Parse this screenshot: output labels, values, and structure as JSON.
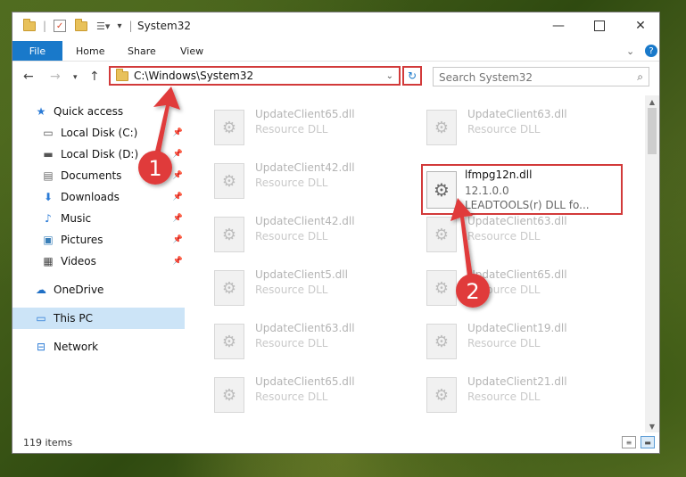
{
  "window": {
    "title": "System32"
  },
  "ribbon": {
    "tabs": [
      "File",
      "Home",
      "Share",
      "View"
    ]
  },
  "address": {
    "path": "C:\\Windows\\System32"
  },
  "search": {
    "placeholder": "Search System32"
  },
  "sidebar": {
    "items": [
      {
        "label": "Quick access",
        "icon": "star-icon",
        "pinned": false
      },
      {
        "label": "Local Disk (C:)",
        "icon": "drive-icon",
        "pinned": true
      },
      {
        "label": "Local Disk (D:)",
        "icon": "drive-icon",
        "pinned": true
      },
      {
        "label": "Documents",
        "icon": "document-icon",
        "pinned": true
      },
      {
        "label": "Downloads",
        "icon": "download-icon",
        "pinned": true
      },
      {
        "label": "Music",
        "icon": "music-icon",
        "pinned": true
      },
      {
        "label": "Pictures",
        "icon": "picture-icon",
        "pinned": true
      },
      {
        "label": "Videos",
        "icon": "video-icon",
        "pinned": true
      },
      {
        "label": "OneDrive",
        "icon": "cloud-icon",
        "pinned": false
      },
      {
        "label": "This PC",
        "icon": "computer-icon",
        "pinned": false,
        "selected": true
      },
      {
        "label": "Network",
        "icon": "network-icon",
        "pinned": false
      }
    ]
  },
  "files": {
    "left": [
      {
        "name": "UpdateClient65.dll",
        "desc": "Resource DLL"
      },
      {
        "name": "UpdateClient42.dll",
        "desc": "Resource DLL"
      },
      {
        "name": "UpdateClient42.dll",
        "desc": "Resource DLL"
      },
      {
        "name": "UpdateClient5.dll",
        "desc": "Resource DLL"
      },
      {
        "name": "UpdateClient63.dll",
        "desc": "Resource DLL"
      },
      {
        "name": "UpdateClient65.dll",
        "desc": "Resource DLL"
      }
    ],
    "right": [
      {
        "name": "UpdateClient63.dll",
        "desc": "Resource DLL"
      },
      {
        "name": "",
        "desc": ""
      },
      {
        "name": "UpdateClient63.dll",
        "desc": "Resource DLL"
      },
      {
        "name": "UpdateClient65.dll",
        "desc": "Resource DLL"
      },
      {
        "name": "UpdateClient19.dll",
        "desc": "Resource DLL"
      },
      {
        "name": "UpdateClient21.dll",
        "desc": "Resource DLL"
      }
    ],
    "target": {
      "name": "lfmpg12n.dll",
      "version": "12.1.0.0",
      "desc": "LEADTOOLS(r) DLL fo..."
    }
  },
  "status": {
    "count": "119 items"
  },
  "annotations": [
    {
      "label": "1",
      "color": "#e03b3b"
    },
    {
      "label": "2",
      "color": "#e03b3b"
    }
  ]
}
